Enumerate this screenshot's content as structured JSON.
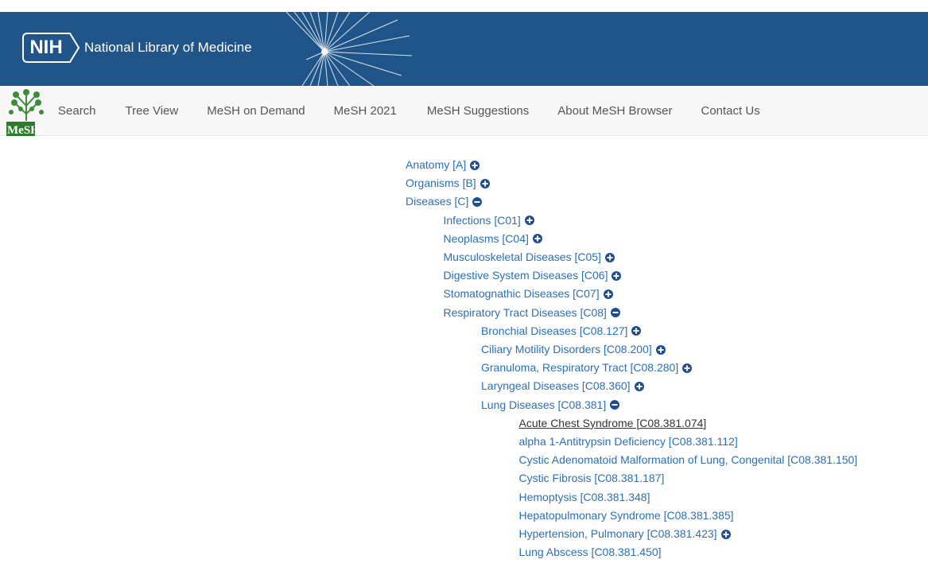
{
  "header": {
    "nih_label": "NIH",
    "title": "National Library of Medicine",
    "brand_color": "#20558a"
  },
  "navbar": {
    "logo_text": "MeSH",
    "items": [
      {
        "label": "Search"
      },
      {
        "label": "Tree View"
      },
      {
        "label": "MeSH on Demand"
      },
      {
        "label": "MeSH 2021"
      },
      {
        "label": "MeSH Suggestions"
      },
      {
        "label": "About MeSH Browser"
      },
      {
        "label": "Contact Us"
      }
    ]
  },
  "tree": {
    "link_color": "#2a6fb7",
    "nodes": [
      {
        "label": "Anatomy [A]",
        "level": 0,
        "toggle": "expand"
      },
      {
        "label": "Organisms [B]",
        "level": 0,
        "toggle": "expand"
      },
      {
        "label": "Diseases [C]",
        "level": 0,
        "toggle": "collapse"
      },
      {
        "label": "Infections [C01]",
        "level": 1,
        "toggle": "expand"
      },
      {
        "label": "Neoplasms [C04]",
        "level": 1,
        "toggle": "expand"
      },
      {
        "label": "Musculoskeletal Diseases [C05]",
        "level": 1,
        "toggle": "expand"
      },
      {
        "label": "Digestive System Diseases [C06]",
        "level": 1,
        "toggle": "expand"
      },
      {
        "label": "Stomatognathic Diseases [C07]",
        "level": 1,
        "toggle": "expand"
      },
      {
        "label": "Respiratory Tract Diseases [C08]",
        "level": 1,
        "toggle": "collapse"
      },
      {
        "label": "Bronchial Diseases [C08.127]",
        "level": 2,
        "toggle": "expand"
      },
      {
        "label": "Ciliary Motility Disorders [C08.200]",
        "level": 2,
        "toggle": "expand"
      },
      {
        "label": "Granuloma, Respiratory Tract [C08.280]",
        "level": 2,
        "toggle": "expand"
      },
      {
        "label": "Laryngeal Diseases [C08.360]",
        "level": 2,
        "toggle": "expand"
      },
      {
        "label": "Lung Diseases [C08.381]",
        "level": 2,
        "toggle": "collapse"
      },
      {
        "label": "Acute Chest Syndrome [C08.381.074]",
        "level": 3,
        "toggle": "none",
        "current": true
      },
      {
        "label": "alpha 1-Antitrypsin Deficiency [C08.381.112]",
        "level": 3,
        "toggle": "none"
      },
      {
        "label": "Cystic Adenomatoid Malformation of Lung, Congenital [C08.381.150]",
        "level": 3,
        "toggle": "none"
      },
      {
        "label": "Cystic Fibrosis [C08.381.187]",
        "level": 3,
        "toggle": "none"
      },
      {
        "label": "Hemoptysis [C08.381.348]",
        "level": 3,
        "toggle": "none"
      },
      {
        "label": "Hepatopulmonary Syndrome [C08.381.385]",
        "level": 3,
        "toggle": "none"
      },
      {
        "label": "Hypertension, Pulmonary [C08.381.423]",
        "level": 3,
        "toggle": "expand"
      },
      {
        "label": "Lung Abscess [C08.381.450]",
        "level": 3,
        "toggle": "none"
      }
    ]
  }
}
